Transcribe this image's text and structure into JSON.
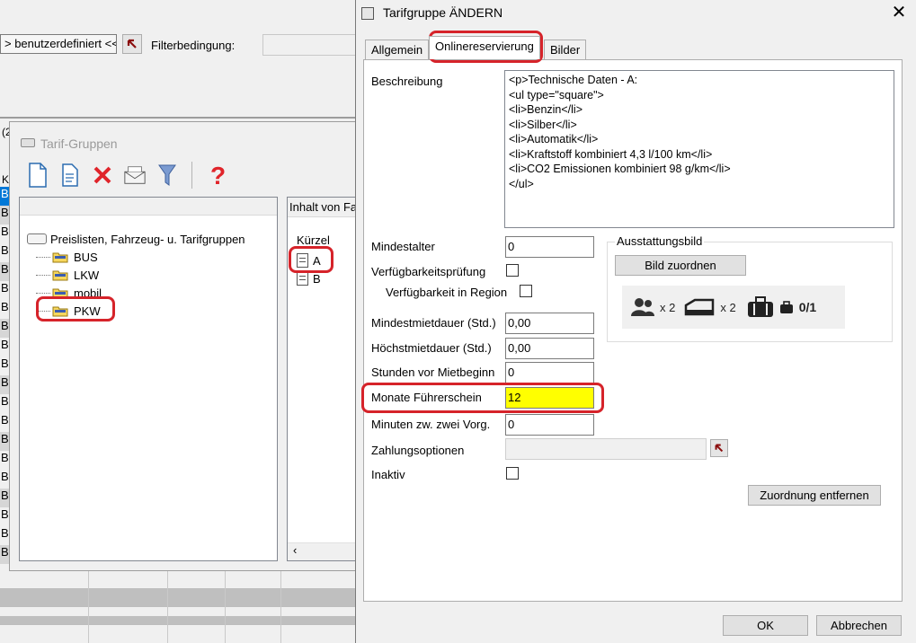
{
  "background": {
    "combo_value": "> benutzerdefiniert <<-",
    "filter_label": "Filterbedingung:",
    "col_letter": "(2",
    "left_col_top": "K",
    "left_col_letters": [
      "B",
      "B",
      "B",
      "B",
      "B",
      "B",
      "B",
      "B",
      "B",
      "B",
      "B",
      "B",
      "B",
      "B",
      "B",
      "B",
      "B",
      "B",
      "B",
      "B"
    ]
  },
  "tarif_gruppen": {
    "title": "Tarif-Gruppen",
    "tree_root": "Preislisten, Fahrzeug- u. Tarifgruppen",
    "tree_items": [
      {
        "label": "BUS"
      },
      {
        "label": "LKW"
      },
      {
        "label": "mobil"
      },
      {
        "label": "PKW"
      }
    ],
    "right_header": "Inhalt von Fa",
    "col_header": "Kürzel",
    "list_items": [
      "A",
      "B"
    ]
  },
  "dialog": {
    "title": "Tarifgruppe ÄNDERN",
    "close_glyph": "✕",
    "tabs": [
      "Allgemein",
      "Onlinereservierung",
      "Bilder"
    ],
    "beschreibung_label": "Beschreibung",
    "beschreibung_value": "<p>Technische Daten - A:\n<ul type=\"square\">\n<li>Benzin</li>\n<li>Silber</li>\n<li>Automatik</li>\n<li>Kraftstoff kombiniert 4,3 l/100 km</li>\n<li>CO2 Emissionen kombiniert 98 g/km</li>\n</ul>",
    "fields": {
      "mindestalter": {
        "label": "Mindestalter",
        "value": "0"
      },
      "verfuegbarkeitspruefung": {
        "label": "Verfügbarkeitsprüfung"
      },
      "verfuegbarkeit_region": {
        "label": "Verfügbarkeit in Region"
      },
      "mindestmietdauer": {
        "label": "Mindestmietdauer (Std.)",
        "value": "0,00"
      },
      "hoechstmietdauer": {
        "label": "Höchstmietdauer (Std.)",
        "value": "0,00"
      },
      "stunden_vor_mietbeginn": {
        "label": "Stunden vor Mietbeginn",
        "value": "0"
      },
      "monate_fuehrerschein": {
        "label": "Monate Führerschein",
        "value": "12"
      },
      "minuten_zw_zwei_vorg": {
        "label": "Minuten zw. zwei Vorg.",
        "value": "0"
      },
      "zahlungsoptionen": {
        "label": "Zahlungsoptionen",
        "value": ""
      },
      "inaktiv": {
        "label": "Inaktiv"
      }
    },
    "ausstattungsbild": {
      "title": "Ausstattungsbild",
      "assign_button": "Bild zuordnen",
      "persons": "x 2",
      "doors": "x 2",
      "luggage": "0/1"
    },
    "remove_button": "Zuordnung entfernen",
    "ok_button": "OK",
    "cancel_button": "Abbrechen",
    "highlight_color": "#ffff00",
    "annotation_color": "#d6232a"
  }
}
